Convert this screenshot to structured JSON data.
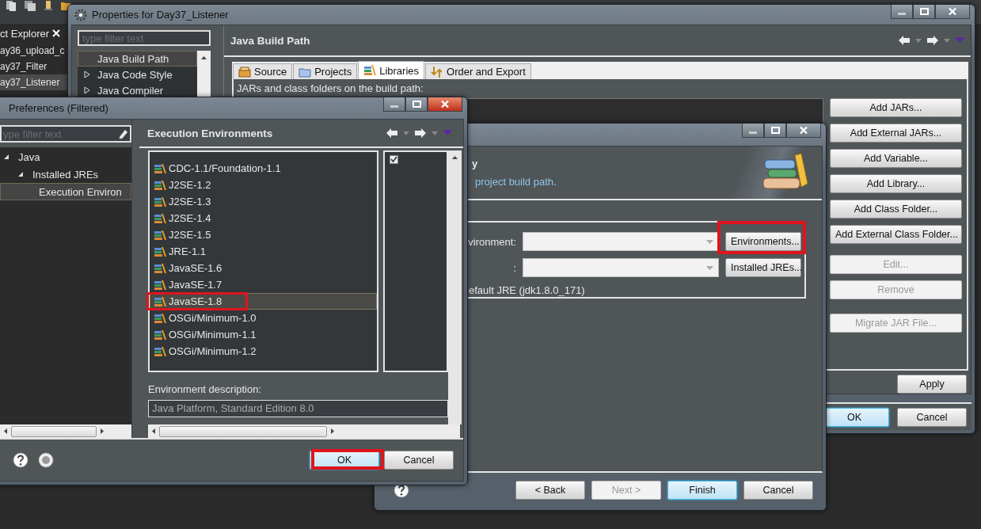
{
  "explorer": {
    "title": "ct Explorer",
    "items": [
      {
        "label": "ay36_upload_c",
        "selected": false
      },
      {
        "label": "ay37_Filter",
        "selected": false
      },
      {
        "label": "ay37_Listener",
        "selected": true
      }
    ]
  },
  "properties": {
    "title": "Properties for Day37_Listener",
    "active": false,
    "filter": {
      "placeholder": "type filter text"
    },
    "tree": [
      {
        "label": "Java Build Path",
        "selected": true
      },
      {
        "label": "Java Code Style",
        "selected": false,
        "expanded": false
      },
      {
        "label": "Java Compiler",
        "selected": false,
        "expanded": false
      }
    ],
    "heading": "Java Build Path",
    "tabs": [
      {
        "label": "Source",
        "kind": "source",
        "selected": false
      },
      {
        "label": "Projects",
        "kind": "projects",
        "selected": false
      },
      {
        "label": "Libraries",
        "kind": "libraries",
        "selected": true
      },
      {
        "label": "Order and Export",
        "kind": "order",
        "selected": false
      }
    ],
    "caption": "JARs and class folders on the build path:",
    "side_buttons": [
      {
        "label": "Add JARs...",
        "disabled": false
      },
      {
        "label": "Add External JARs...",
        "disabled": false
      },
      {
        "label": "Add Variable...",
        "disabled": false
      },
      {
        "label": "Add Library...",
        "disabled": false
      },
      {
        "label": "Add Class Folder...",
        "disabled": false
      },
      {
        "label": "Add External Class Folder...",
        "disabled": false
      },
      {
        "label": "Edit...",
        "disabled": true
      },
      {
        "label": "Remove",
        "disabled": true
      },
      {
        "label": "Migrate JAR File...",
        "disabled": true
      }
    ],
    "apply": "Apply",
    "buttons": [
      {
        "label": "OK",
        "default": true
      },
      {
        "label": "Cancel",
        "default": false
      }
    ]
  },
  "wizard": {
    "active": false,
    "header_title": "y",
    "header_description": "project build path.",
    "rows": [
      {
        "label": "vironment:",
        "button": {
          "label": "Environments...",
          "highlighted": true
        }
      },
      {
        "label": ":",
        "button": {
          "label": "Installed JREs...",
          "highlighted": false
        }
      }
    ],
    "default_jre": "efault JRE (jdk1.8.0_171)",
    "buttons": [
      {
        "label": "< Back",
        "disabled": false,
        "default": false
      },
      {
        "label": "Next >",
        "disabled": true,
        "default": false
      },
      {
        "label": "Finish",
        "disabled": false,
        "default": true
      },
      {
        "label": "Cancel",
        "disabled": false,
        "default": false
      }
    ]
  },
  "preferences": {
    "title": "Preferences (Filtered)",
    "active": true,
    "filter": {
      "placeholder": "ype filter text"
    },
    "tree": [
      {
        "label": "Java",
        "expanded": true,
        "selected": false,
        "children": [
          {
            "label": "Installed JREs",
            "expanded": true,
            "selected": false,
            "children": [
              {
                "label": "Execution Environ",
                "selected": true
              }
            ]
          }
        ]
      }
    ],
    "heading": "Execution Environments",
    "environments": [
      {
        "label": "CDC-1.1/Foundation-1.1",
        "selected": false,
        "highlighted": false
      },
      {
        "label": "J2SE-1.2",
        "selected": false,
        "highlighted": false
      },
      {
        "label": "J2SE-1.3",
        "selected": false,
        "highlighted": false
      },
      {
        "label": "J2SE-1.4",
        "selected": false,
        "highlighted": false
      },
      {
        "label": "J2SE-1.5",
        "selected": false,
        "highlighted": false
      },
      {
        "label": "JRE-1.1",
        "selected": false,
        "highlighted": false
      },
      {
        "label": "JavaSE-1.6",
        "selected": false,
        "highlighted": false
      },
      {
        "label": "JavaSE-1.7",
        "selected": false,
        "highlighted": false
      },
      {
        "label": "JavaSE-1.8",
        "selected": true,
        "highlighted": true
      },
      {
        "label": "OSGi/Minimum-1.0",
        "selected": false,
        "highlighted": false
      },
      {
        "label": "OSGi/Minimum-1.1",
        "selected": false,
        "highlighted": false
      },
      {
        "label": "OSGi/Minimum-1.2",
        "selected": false,
        "highlighted": false
      }
    ],
    "description_label": "Environment description:",
    "description": "Java Platform, Standard Edition 8.0",
    "buttons": [
      {
        "label": "OK",
        "default": true,
        "highlighted": true
      },
      {
        "label": "Cancel",
        "default": false,
        "highlighted": false
      }
    ]
  }
}
